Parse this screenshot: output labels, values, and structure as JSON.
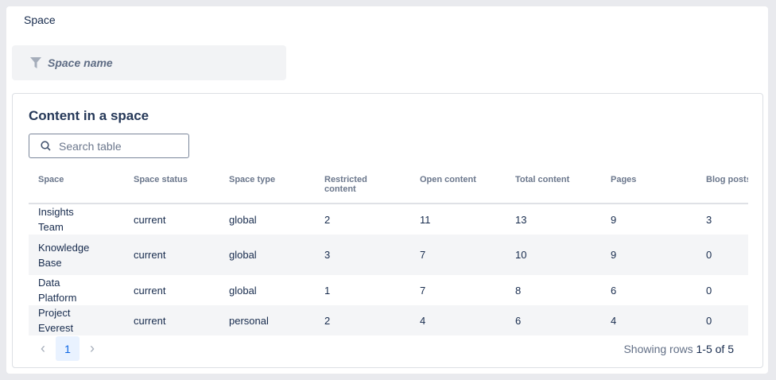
{
  "filter_label": "Space",
  "filter_placeholder": "Space name",
  "card_title": "Content in a space",
  "search_placeholder": "Search table",
  "columns": [
    "Space",
    "Space status",
    "Space type",
    "Restricted content",
    "Open content",
    "Total content",
    "Pages",
    "Blog posts"
  ],
  "rows": [
    [
      "Insights Team",
      "current",
      "global",
      "2",
      "11",
      "13",
      "9",
      "3"
    ],
    [
      "Knowledge Base",
      "current",
      "global",
      "3",
      "7",
      "10",
      "9",
      "0"
    ],
    [
      "Data Platform",
      "current",
      "global",
      "1",
      "7",
      "8",
      "6",
      "0"
    ],
    [
      "Project Everest",
      "current",
      "personal",
      "2",
      "4",
      "6",
      "4",
      "0"
    ]
  ],
  "pagination": {
    "prev": "‹",
    "page": "1",
    "next": "›"
  },
  "status": {
    "prefix": "Showing rows ",
    "range": "1-5 of 5"
  }
}
